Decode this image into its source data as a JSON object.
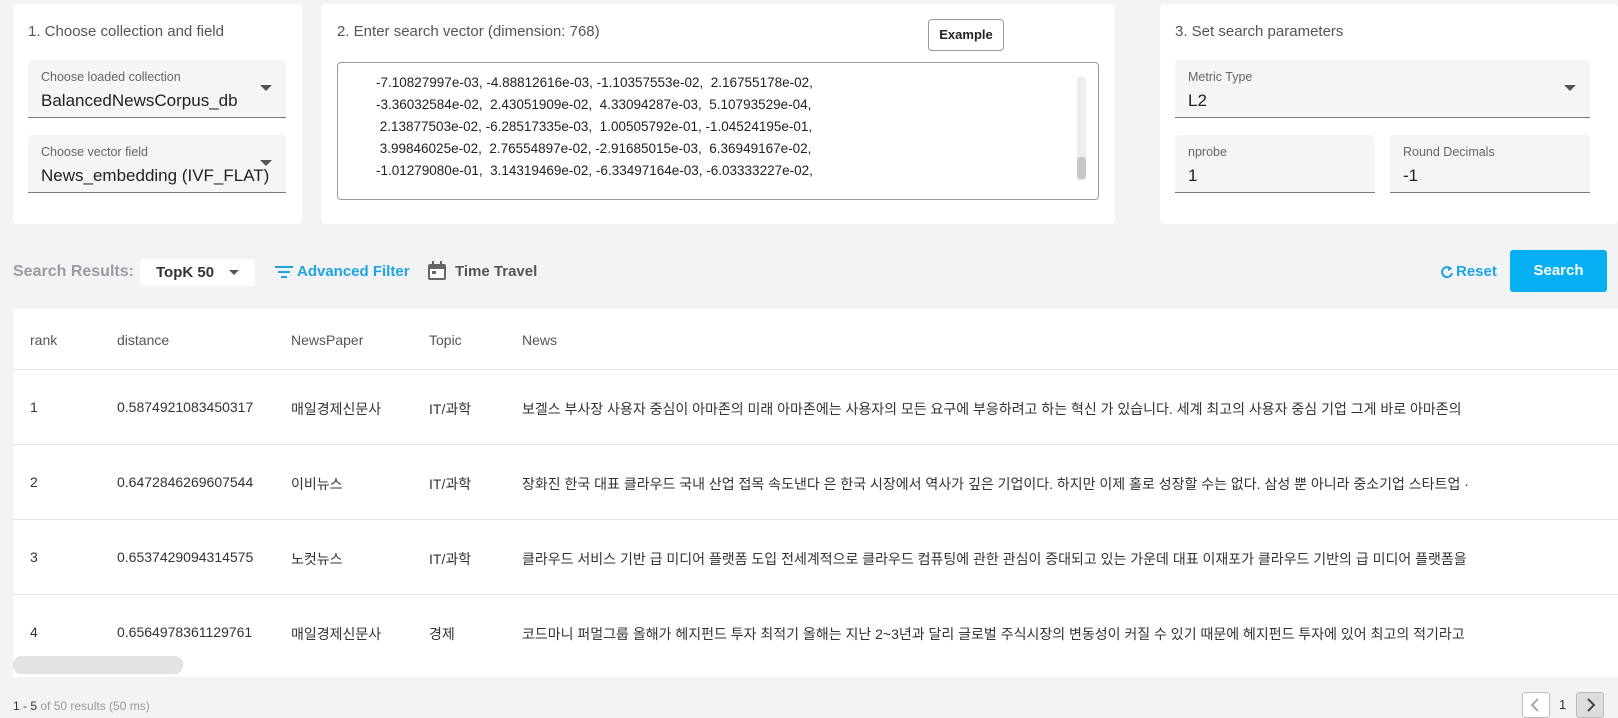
{
  "panel1": {
    "title": "1. Choose collection and field",
    "collection": {
      "label": "Choose loaded collection",
      "value": "BalancedNewsCorpus_db"
    },
    "field": {
      "label": "Choose vector field",
      "value": "News_embedding (IVF_FLAT)"
    }
  },
  "panel2": {
    "title": "2. Enter search vector (dimension: 768)",
    "example_button": "Example",
    "vector_lines": [
      "-7.10827997e-03, -4.88812616e-03, -1.10357553e-02,  2.16755178e-02,",
      "-3.36032584e-02,  2.43051909e-02,  4.33094287e-03,  5.10793529e-04,",
      " 2.13877503e-02, -6.28517335e-03,  1.00505792e-01, -1.04524195e-01,",
      " 3.99846025e-02,  2.76554897e-02, -2.91685015e-03,  6.36949167e-02,",
      "-1.01279080e-01,  3.14319469e-02, -6.33497164e-03, -6.03333227e-02,"
    ]
  },
  "panel3": {
    "title": "3. Set search parameters",
    "metric": {
      "label": "Metric Type",
      "value": "L2"
    },
    "nprobe": {
      "label": "nprobe",
      "value": "1"
    },
    "round": {
      "label": "Round Decimals",
      "value": "-1"
    }
  },
  "toolbar": {
    "results_label": "Search Results:",
    "topk": "TopK 50",
    "advanced_filter": "Advanced Filter",
    "time_travel": "Time Travel",
    "reset": "Reset",
    "search": "Search"
  },
  "table": {
    "headers": [
      "rank",
      "distance",
      "NewsPaper",
      "Topic",
      "News"
    ],
    "rows": [
      [
        "1",
        "0.5874921083450317",
        "매일경제신문사",
        "IT/과학",
        "보겔스 부사장 사용자 중심이 아마존의 미래 아마존에는 사용자의 모든 요구에 부응하려고 하는 혁신 가 있습니다. 세계 최고의 사용자 중심 기업 그게 바로 아마존의"
      ],
      [
        "2",
        "0.6472846269607544",
        "이비뉴스",
        "IT/과학",
        "장화진 한국 대표 클라우드 국내 산업 접목 속도낸다 은 한국 시장에서 역사가 깊은 기업이다. 하지만 이제 홀로 성장할 수는 없다. 삼성 뿐 아니라 중소기업 스타트업 ·"
      ],
      [
        "3",
        "0.6537429094314575",
        "노컷뉴스",
        "IT/과학",
        "클라우드 서비스 기반 급 미디어 플랫폼 도입 전세계적으로 클라우드 컴퓨팅에 관한 관심이 증대되고 있는 가운데 대표 이재포가 클라우드 기반의 급 미디어 플랫폼을"
      ],
      [
        "4",
        "0.6564978361129761",
        "매일경제신문사",
        "경제",
        "코드마니 퍼멀그룹 올해가 헤지펀드 투자 최적기 올해는 지난 2~3년과 달리 글로벌 주식시장의 변동성이 커질 수 있기 때문에 헤지펀드 투자에 있어 최고의 적기라고"
      ]
    ]
  },
  "footer": {
    "range": "1 - 5",
    "summary": "of 50 results (50 ms)",
    "page": "1"
  },
  "colors": {
    "accent": "#06aff2",
    "link": "#1ea4de",
    "muted": "#9a9aa3"
  }
}
